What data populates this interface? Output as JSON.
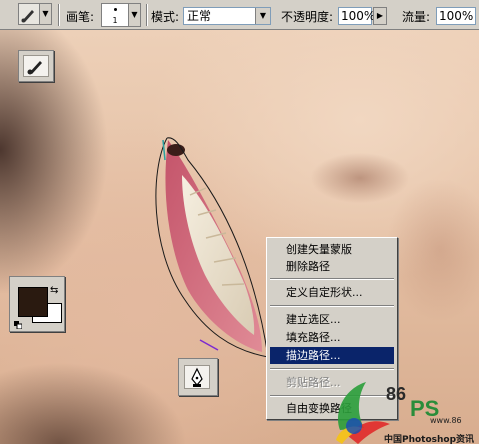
{
  "options_bar": {
    "brush_label": "画笔:",
    "brush_size": "1",
    "mode_label": "模式:",
    "mode_value": "正常",
    "opacity_label": "不透明度:",
    "opacity_value": "100%",
    "flow_label": "流量:",
    "flow_value": "100%"
  },
  "context_menu": {
    "items": [
      {
        "label": "创建矢量蒙版",
        "state": "normal"
      },
      {
        "label": "删除路径",
        "state": "normal"
      },
      {
        "label": "定义自定形状...",
        "state": "normal"
      },
      {
        "label": "建立选区...",
        "state": "normal"
      },
      {
        "label": "填充路径...",
        "state": "normal"
      },
      {
        "label": "描边路径...",
        "state": "highlighted"
      },
      {
        "label": "剪贴路径...",
        "state": "disabled"
      },
      {
        "label": "自由变换路径",
        "state": "normal"
      }
    ]
  },
  "colors": {
    "foreground": "#2a1a10",
    "background": "#ffffff",
    "menu_highlight": "#0a246a",
    "path_stroke": "#1a1a1a"
  },
  "icons": [
    "brush-icon",
    "pen-icon",
    "swap-colors-icon",
    "default-colors-icon"
  ],
  "watermark": {
    "number": "86",
    "ps": "PS",
    "url": "www.86",
    "site": "中国Photoshop资讯"
  }
}
